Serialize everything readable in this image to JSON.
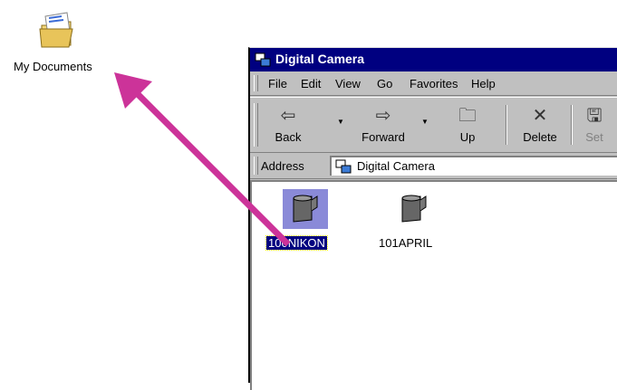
{
  "desktop": {
    "my_documents_label": "My Documents"
  },
  "window": {
    "title": "Digital Camera",
    "menu": [
      "File",
      "Edit",
      "View",
      "Go",
      "Favorites",
      "Help"
    ],
    "toolbar": {
      "back": "Back",
      "forward": "Forward",
      "up": "Up",
      "delete": "Delete",
      "setup_partial": "Set"
    },
    "address": {
      "label": "Address",
      "value": "Digital Camera"
    },
    "items": [
      {
        "name": "100NIKON",
        "selected": true
      },
      {
        "name": "101APRIL",
        "selected": false
      }
    ]
  },
  "colors": {
    "arrow": "#cc3399",
    "titlebar": "#000080",
    "selection": "#8a8ad8"
  }
}
